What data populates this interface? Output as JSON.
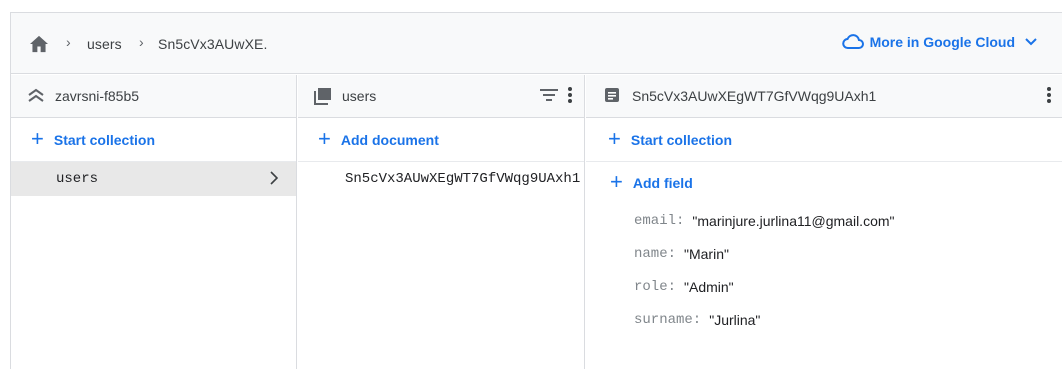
{
  "breadcrumb": {
    "items": [
      "users",
      "Sn5cVx3AUwXE."
    ],
    "cloud_link": "More in Google Cloud"
  },
  "columns": {
    "project": {
      "title": "zavrsni-f85b5",
      "add_label": "Start collection",
      "items": [
        "users"
      ]
    },
    "collection": {
      "title": "users",
      "add_label": "Add document",
      "items": [
        "Sn5cVx3AUwXEgWT7GfVWqg9UAxh1"
      ]
    },
    "document": {
      "title": "Sn5cVx3AUwXEgWT7GfVWqg9UAxh1",
      "add_collection_label": "Start collection",
      "add_field_label": "Add field",
      "fields": [
        {
          "key": "email:",
          "value": "\"marinjure.jurlina11@gmail.com\""
        },
        {
          "key": "name:",
          "value": "\"Marin\""
        },
        {
          "key": "role:",
          "value": "\"Admin\""
        },
        {
          "key": "surname:",
          "value": "\"Jurlina\""
        }
      ]
    }
  },
  "colors": {
    "accent": "#1a73e8",
    "border": "#dadce0",
    "header_bg": "#f8f9fa",
    "selected_bg": "#e8e8e8"
  },
  "icons": [
    "home-icon",
    "chevron-right-icon",
    "cloud-icon",
    "chevron-down-icon",
    "database-icon",
    "collection-icon",
    "filter-icon",
    "more-vert-icon",
    "document-icon",
    "plus-icon"
  ]
}
